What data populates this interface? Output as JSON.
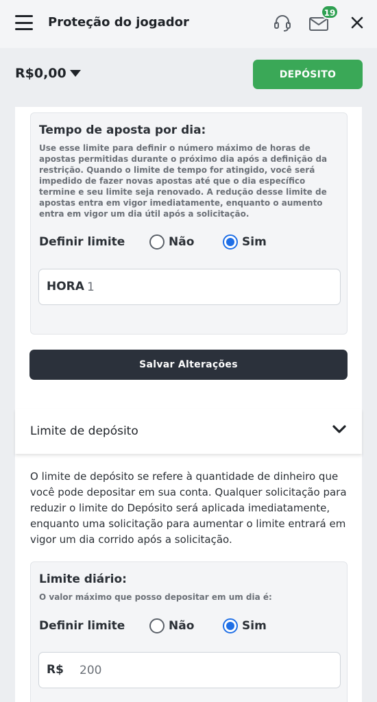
{
  "header": {
    "title": "Proteção do jogador",
    "menu_icon": "hamburger-menu-icon",
    "support_icon": "headset-icon",
    "mail_icon": "envelope-icon",
    "mail_badge": "19",
    "close_icon": "close-icon"
  },
  "balance": {
    "amount": "R$0,00",
    "caret_icon": "caret-down-icon",
    "deposit_label": "DEPÓSITO"
  },
  "betting_time": {
    "title": "Tempo de aposta por dia:",
    "description": "Use esse limite para definir o número máximo de horas de apostas permitidas durante o próximo dia após a definição da restrição. Quando o limite de tempo for atingido, você será impedido de fazer novas apostas até que o dia específico termine e seu limite seja renovado. A redução desse limite de apostas entra em vigor imediatamente, enquanto o aumento entra em vigor um dia útil após a solicitação.",
    "set_limit_label": "Definir limite",
    "option_no": "Não",
    "option_yes": "Sim",
    "selected": "Sim",
    "field_prefix": "HORA",
    "field_value": "1"
  },
  "save_button": "Salvar Alterações",
  "deposit_limit": {
    "section_title": "Limite de depósito",
    "chevron_icon": "chevron-down-icon",
    "info": "O limite de depósito se refere à quantidade de dinheiro que você pode depositar em sua conta. Qualquer solicitação para reduzir o limite do Depósito será aplicada imediatamente, enquanto uma solicitação para aumentar o limite entrará em vigor um dia corrido após a solicitação.",
    "daily": {
      "title": "Limite diário:",
      "description": "O valor máximo que posso depositar em um dia é:",
      "set_limit_label": "Definir limite",
      "option_no": "Não",
      "option_yes": "Sim",
      "selected": "Sim",
      "field_prefix": "R$",
      "field_value": "200"
    }
  },
  "colors": {
    "accent_green": "#3aa857",
    "badge_green": "#2fa052",
    "dark_button": "#2b313b",
    "radio_blue": "#1f6fe6"
  }
}
